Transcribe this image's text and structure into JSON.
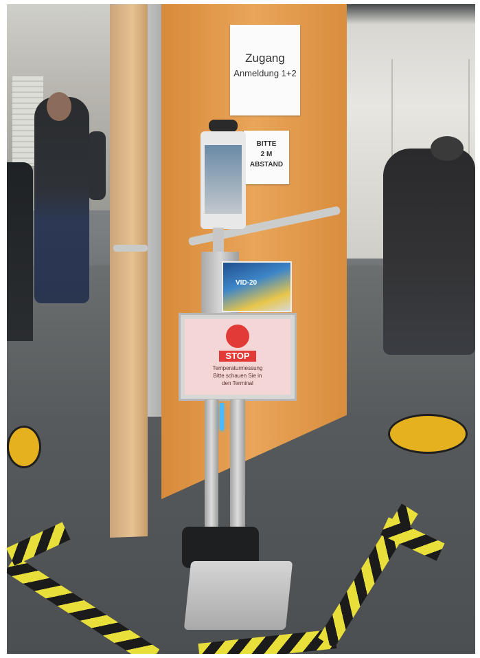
{
  "signs": {
    "zugang_line1": "Zugang",
    "zugang_line2": "Anmeldung 1+2",
    "bitte_line1": "BITTE",
    "bitte_line2": "2 M",
    "bitte_line3": "ABSTAND",
    "info_card_text": "VID-20",
    "stop_label": "STOP",
    "stop_text_line1": "Temperaturmessung",
    "stop_text_line2": "Bitte schauen Sie in",
    "stop_text_line3": "den Terminal"
  },
  "colors": {
    "door": "#e9a559",
    "tape_yellow": "#e9df3a",
    "tape_black": "#1b1b1b",
    "stop_red": "#e23b37",
    "floor": "#565a5c"
  }
}
